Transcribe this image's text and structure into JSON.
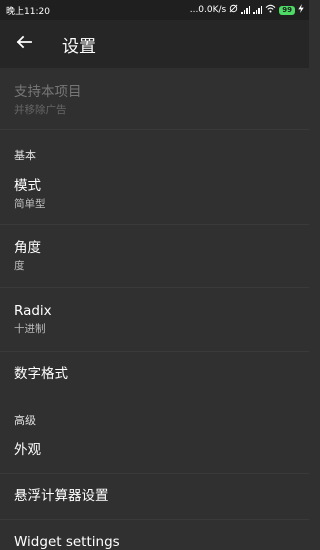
{
  "status_bar": {
    "time": "晚上11:20",
    "network_speed": "...0.0K/s",
    "battery": "99"
  },
  "app_bar": {
    "title": "设置"
  },
  "settings": {
    "support": {
      "title": "支持本项目",
      "summary": "并移除广告"
    },
    "basic_header": "基本",
    "mode": {
      "title": "模式",
      "summary": "简单型"
    },
    "angle": {
      "title": "角度",
      "summary": "度"
    },
    "radix": {
      "title": "Radix",
      "summary": "十进制"
    },
    "number_format": {
      "title": "数字格式"
    },
    "advanced_header": "高级",
    "appearance": {
      "title": "外观"
    },
    "floating_calc": {
      "title": "悬浮计算器设置"
    },
    "widget": {
      "title": "Widget settings"
    }
  }
}
